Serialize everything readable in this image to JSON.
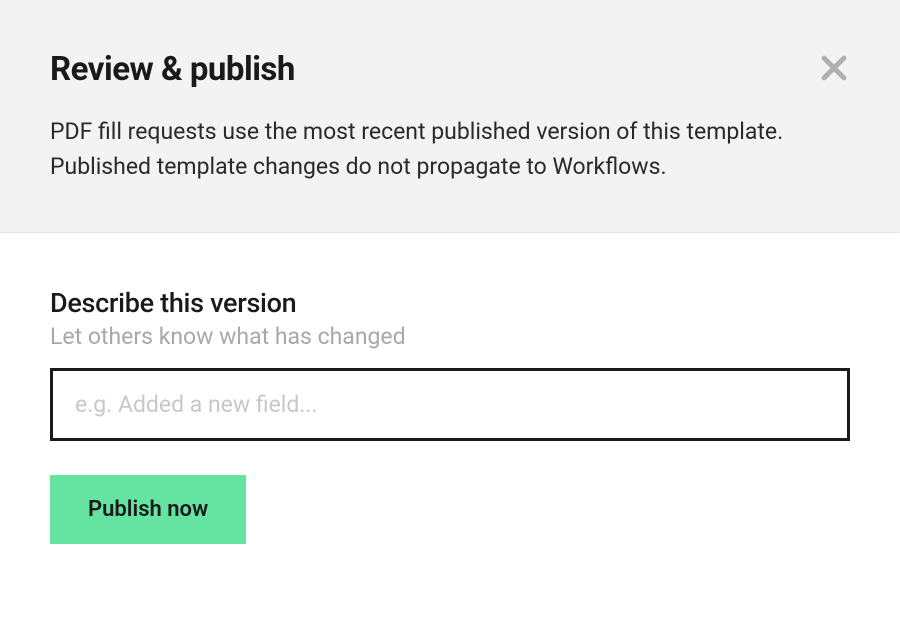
{
  "header": {
    "title": "Review & publish",
    "description": "PDF fill requests use the most recent published version of this template. Published template changes do not propagate to Workflows."
  },
  "form": {
    "version_label": "Describe this version",
    "version_helper": "Let others know what has changed",
    "version_placeholder": "e.g. Added a new field...",
    "version_value": ""
  },
  "actions": {
    "publish_label": "Publish now"
  }
}
